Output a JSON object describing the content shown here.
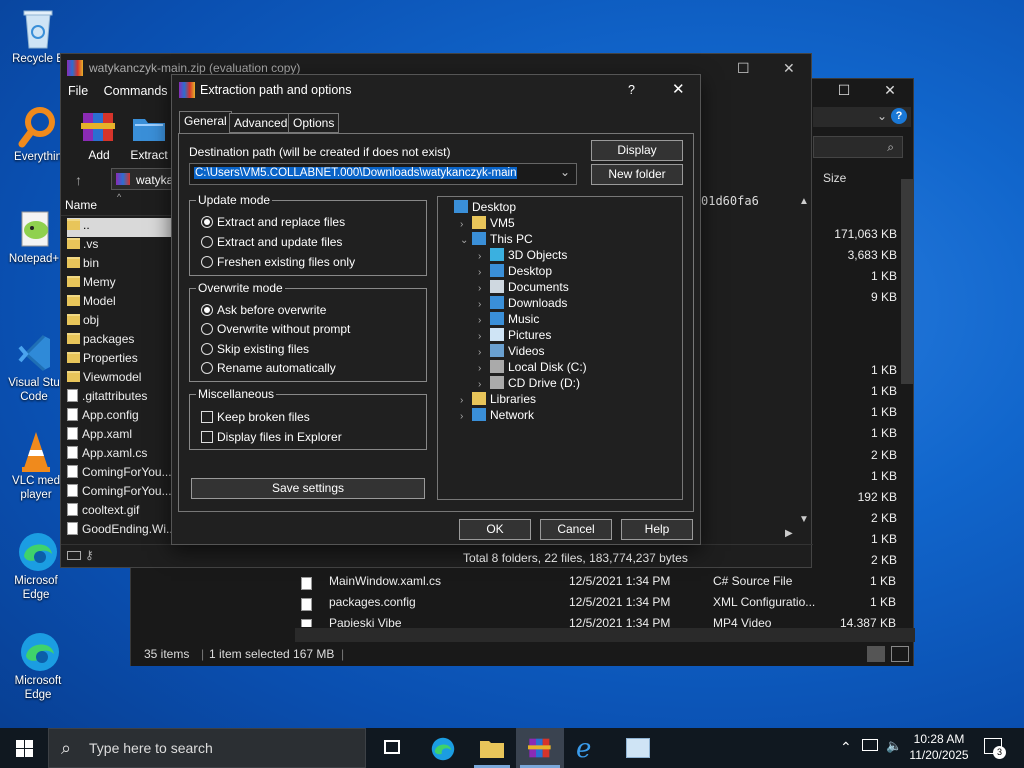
{
  "desktop": {
    "icons": [
      {
        "label": "Recycle Bin"
      },
      {
        "label": "Everything"
      },
      {
        "label": "Notepad++"
      },
      {
        "label": "Visual Studio Code"
      },
      {
        "label": "VLC media player"
      },
      {
        "label": "Microsoft Edge"
      },
      {
        "label": "Microsoft Edge"
      }
    ],
    "icon_labels_visible": [
      "Recycle B",
      "Everythin",
      "Notepad+",
      "Visual Stu\nCode",
      "VLC med\nplayer",
      "Microsof\nEdge",
      "Microsoft\nEdge"
    ]
  },
  "explorer": {
    "size_header": "Size",
    "rows": [
      {
        "size": "171,063 KB"
      },
      {
        "size": "3,683 KB"
      },
      {
        "size": "1 KB"
      },
      {
        "size": "9 KB"
      },
      {
        "size": "1 KB"
      },
      {
        "size": "1 KB"
      },
      {
        "size": "1 KB"
      },
      {
        "size": "1 KB"
      },
      {
        "size": "2 KB"
      },
      {
        "size": "1 KB"
      },
      {
        "size": "192 KB"
      },
      {
        "size": "2 KB"
      },
      {
        "size": "1 KB"
      },
      {
        "size": "2 KB"
      }
    ],
    "bottom_rows": [
      {
        "name": "MainWindow.xaml.cs",
        "date": "12/5/2021 1:34 PM",
        "type": "C# Source File",
        "size": "1 KB"
      },
      {
        "name": "packages.config",
        "date": "12/5/2021 1:34 PM",
        "type": "XML Configuratio...",
        "size": "1 KB"
      },
      {
        "name": "Papieski Vibe",
        "date": "12/5/2021 1:34 PM",
        "type": "MP4 Video",
        "size": "14,387 KB"
      }
    ],
    "status": {
      "items": "35 items",
      "selected": "1 item selected  167 MB"
    },
    "hash_text": "01d60fa6"
  },
  "winrar": {
    "title": "watykanczyk-main.zip (evaluation copy)",
    "menu": [
      "File",
      "Commands"
    ],
    "toolbar": {
      "add": "Add",
      "extract": "Extract"
    },
    "path": "watyka",
    "name_header": "Name",
    "files": [
      "..",
      ".vs",
      "bin",
      "Memy",
      "Model",
      "obj",
      "packages",
      "Properties",
      "Viewmodel",
      ".gitattributes",
      "App.config",
      "App.xaml",
      "App.xaml.cs",
      "ComingForYou...",
      "ComingForYou...",
      "cooltext.gif",
      "GoodEnding.Wi..."
    ],
    "status_total": "Total 8 folders, 22 files, 183,774,237 bytes"
  },
  "dialog": {
    "title": "Extraction path and options",
    "help_glyph": "?",
    "tabs": [
      "General",
      "Advanced",
      "Options"
    ],
    "destination_label": "Destination path (will be created if does not exist)",
    "destination_value": "C:\\Users\\VM5.COLLABNET.000\\Downloads\\watykanczyk-main",
    "display_button": "Display",
    "new_folder_button": "New folder",
    "update_mode": {
      "title": "Update mode",
      "options": [
        "Extract and replace files",
        "Extract and update files",
        "Freshen existing files only"
      ],
      "selected": 0
    },
    "overwrite_mode": {
      "title": "Overwrite mode",
      "options": [
        "Ask before overwrite",
        "Overwrite without prompt",
        "Skip existing files",
        "Rename automatically"
      ],
      "selected": 0
    },
    "misc": {
      "title": "Miscellaneous",
      "options": [
        "Keep broken files",
        "Display files in Explorer"
      ]
    },
    "save_settings": "Save settings",
    "tree": [
      {
        "label": "Desktop",
        "level": 0
      },
      {
        "label": "VM5",
        "level": 1
      },
      {
        "label": "This PC",
        "level": 1
      },
      {
        "label": "3D Objects",
        "level": 2
      },
      {
        "label": "Desktop",
        "level": 2
      },
      {
        "label": "Documents",
        "level": 2
      },
      {
        "label": "Downloads",
        "level": 2
      },
      {
        "label": "Music",
        "level": 2
      },
      {
        "label": "Pictures",
        "level": 2
      },
      {
        "label": "Videos",
        "level": 2
      },
      {
        "label": "Local Disk (C:)",
        "level": 2
      },
      {
        "label": "CD Drive (D:)",
        "level": 2
      },
      {
        "label": "Libraries",
        "level": 1
      },
      {
        "label": "Network",
        "level": 1
      }
    ],
    "ok": "OK",
    "cancel": "Cancel",
    "help": "Help"
  },
  "taskbar": {
    "search_placeholder": "Type here to search",
    "time": "10:28 AM",
    "date": "11/20/2025",
    "notification_count": "3"
  },
  "colors": {
    "accent": "#0078d7",
    "selection": "#0a64c8",
    "folder": "#e8c55a"
  }
}
